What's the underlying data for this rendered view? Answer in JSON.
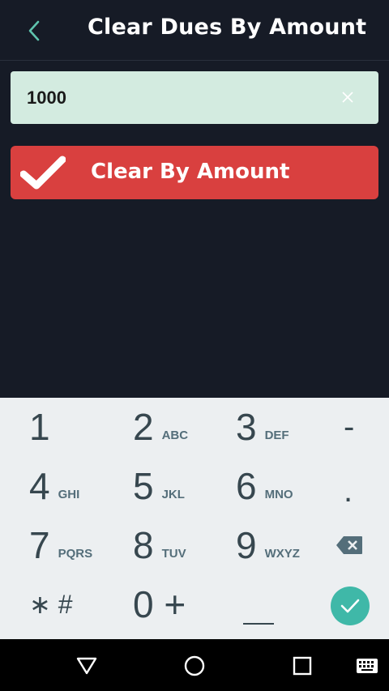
{
  "header": {
    "title": "Clear Dues By Amount",
    "back_icon": "chevron-left-icon"
  },
  "amount_input": {
    "value": "1000",
    "clear_icon": "close-icon"
  },
  "clear_button": {
    "label": "Clear By Amount",
    "icon": "checkmark-icon",
    "color": "#d9403f"
  },
  "keypad": {
    "keys": [
      {
        "digit": "1",
        "letters": ""
      },
      {
        "digit": "2",
        "letters": "ABC"
      },
      {
        "digit": "3",
        "letters": "DEF"
      },
      {
        "digit": "4",
        "letters": "GHI"
      },
      {
        "digit": "5",
        "letters": "JKL"
      },
      {
        "digit": "6",
        "letters": "MNO"
      },
      {
        "digit": "7",
        "letters": "PQRS"
      },
      {
        "digit": "8",
        "letters": "TUV"
      },
      {
        "digit": "9",
        "letters": "WXYZ"
      }
    ],
    "minus": "-",
    "dot": ".",
    "star_hash": "∗ #",
    "zero_plus": "0 +",
    "space": "⎵",
    "backspace_icon": "backspace-icon",
    "enter_icon": "checkmark-icon",
    "accent_color": "#3fb8a8"
  },
  "navbar": {
    "back_icon": "triangle-back-icon",
    "home_icon": "circle-home-icon",
    "recents_icon": "square-recents-icon",
    "keyboard_icon": "keyboard-icon"
  }
}
